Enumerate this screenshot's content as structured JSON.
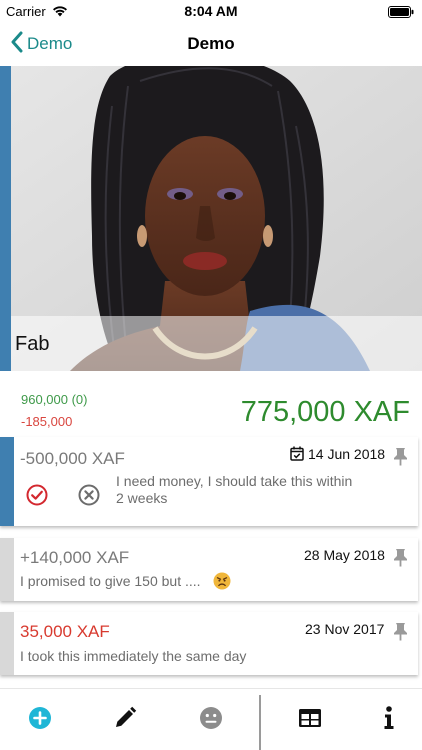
{
  "status_bar": {
    "carrier": "Carrier",
    "time": "8:04 AM"
  },
  "nav": {
    "back_label": "Demo",
    "title": "Demo"
  },
  "profile": {
    "name": "Fab"
  },
  "balance": {
    "credit": "960,000 (0)",
    "debit": "-185,000",
    "total": "775,000 XAF",
    "colors": {
      "positive": "#2e8b2e",
      "negative": "#d83a2f",
      "accent": "#3f7fb0",
      "brand": "#1b8a8a"
    }
  },
  "transactions": [
    {
      "amount": "-500,000 XAF",
      "date": "14 Jun 2018",
      "note_line1": "I need money, I should take this within",
      "note_line2": "2 weeks",
      "icons": [
        "calendar-check-icon",
        "pin-icon",
        "approve-circle-icon",
        "reject-circle-icon"
      ]
    },
    {
      "amount": "+140,000 XAF",
      "date": "28 May 2018",
      "note": "I promised to give 150 but ....",
      "icons": [
        "angry-face-emoji-icon",
        "pin-icon"
      ]
    },
    {
      "amount": "35,000 XAF",
      "date": "23 Nov 2017",
      "note": "I took this immediately the same day",
      "icons": [
        "pin-icon"
      ]
    }
  ],
  "toolbar": {
    "icons": [
      "add-circle-icon",
      "edit-pencil-icon",
      "neutral-face-icon",
      "table-grid-icon",
      "info-icon"
    ]
  }
}
